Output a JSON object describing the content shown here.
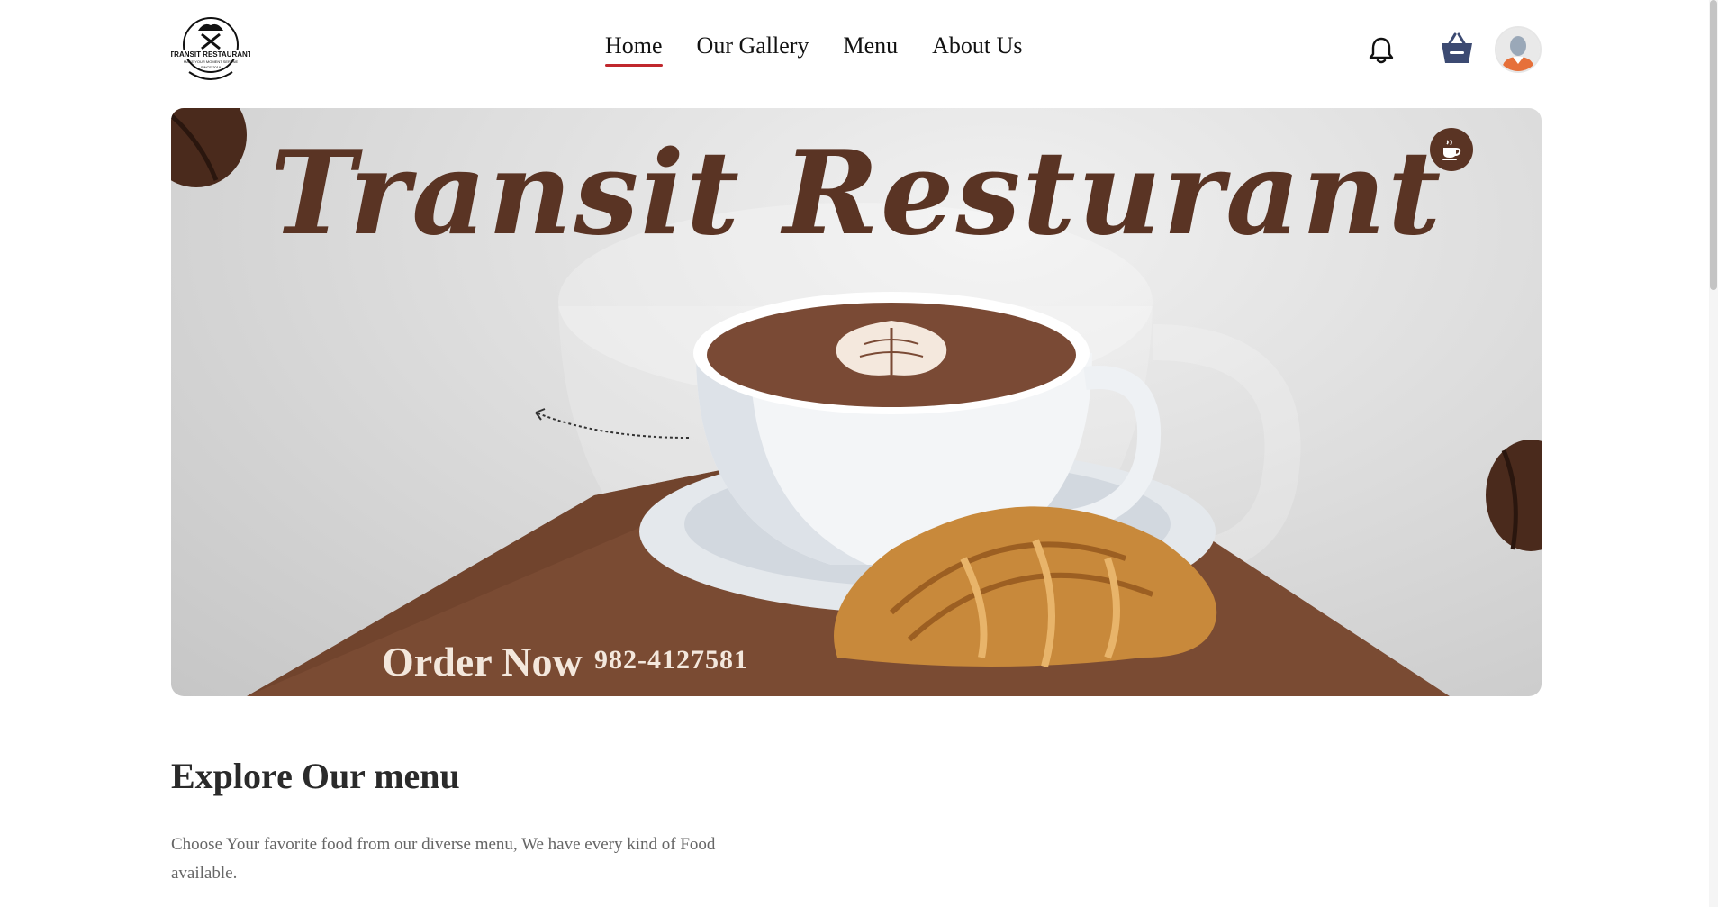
{
  "header": {
    "logo": {
      "name": "TRANSIT RESTAURANT",
      "tagline": "MAKE YOUR MOMENT SERENE",
      "since": "SINCE 2019"
    },
    "nav": [
      {
        "label": "Home",
        "active": true
      },
      {
        "label": "Our Gallery",
        "active": false
      },
      {
        "label": "Menu",
        "active": false
      },
      {
        "label": "About Us",
        "active": false
      }
    ],
    "icons": {
      "notification": "bell-icon",
      "cart": "basket-icon",
      "profile": "avatar"
    }
  },
  "hero": {
    "title": "Transit Resturant",
    "order_label": "Order Now",
    "phone": "982-4127581",
    "badge_icon": "coffee-cup-icon"
  },
  "explore": {
    "title": "Explore Our menu",
    "description": "Choose Your favorite food from our diverse menu, We have every kind of Food available."
  },
  "colors": {
    "accent": "#c0272d",
    "brand_brown": "#5a3424",
    "basket_blue": "#3c4a72"
  }
}
